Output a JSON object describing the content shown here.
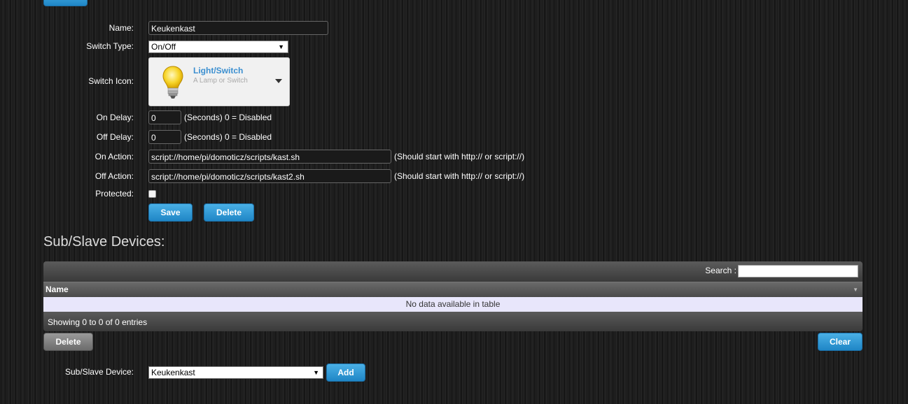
{
  "form": {
    "name_label": "Name:",
    "name_value": "Keukenkast",
    "switch_type_label": "Switch Type:",
    "switch_type_value": "On/Off",
    "switch_icon_label": "Switch Icon:",
    "icon_title": "Light/Switch",
    "icon_desc": "A Lamp or Switch",
    "on_delay_label": "On Delay:",
    "on_delay_value": "0",
    "on_delay_hint": "(Seconds) 0 = Disabled",
    "off_delay_label": "Off Delay:",
    "off_delay_value": "0",
    "off_delay_hint": "(Seconds) 0 = Disabled",
    "on_action_label": "On Action:",
    "on_action_value": "script://home/pi/domoticz/scripts/kast.sh",
    "on_action_hint": "(Should start with http:// or script://)",
    "off_action_label": "Off Action:",
    "off_action_value": "script://home/pi/domoticz/scripts/kast2.sh",
    "off_action_hint": "(Should start with http:// or script://)",
    "protected_label": "Protected:",
    "save_label": "Save",
    "delete_label": "Delete"
  },
  "sub_devices": {
    "heading": "Sub/Slave Devices:",
    "search_label": "Search :",
    "column_name": "Name",
    "empty_text": "No data available in table",
    "info_text": "Showing 0 to 0 of 0 entries",
    "delete_label": "Delete",
    "clear_label": "Clear",
    "device_label": "Sub/Slave Device:",
    "device_value": "Keukenkast",
    "add_label": "Add"
  },
  "colors": {
    "accent": "#2a93d5",
    "icon_title": "#3b8fd0"
  }
}
